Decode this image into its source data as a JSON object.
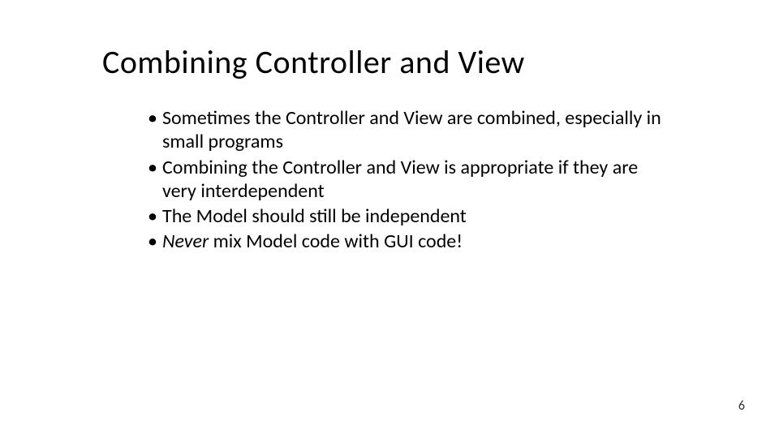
{
  "title": "Combining Controller and View",
  "bullets": [
    {
      "plain": "Sometimes the Controller and View are combined, especially in small programs"
    },
    {
      "plain": "Combining the Controller and View is appropriate if they are very interdependent"
    },
    {
      "plain": "The Model should still be independent"
    },
    {
      "italic_lead": "Never",
      "rest": " mix Model code with GUI code!"
    }
  ],
  "page_number": "6"
}
